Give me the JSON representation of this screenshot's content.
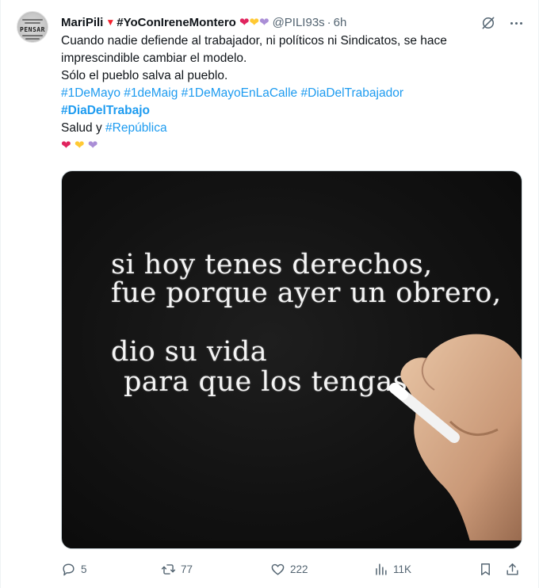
{
  "tweet": {
    "author_name": "MariPili",
    "author_flag": "▼",
    "author_hashtag": "#YoConIreneMontero",
    "handle": "@PILI93s",
    "separator": "·",
    "time": "6h",
    "text_line1": "Cuando nadie defiende al trabajador, ni políticos ni Sindicatos, se hace",
    "text_line2": "imprescindible cambiar el modelo.",
    "text_line3": "Sólo el pueblo salva al pueblo.",
    "hashtags_line": [
      "#1DeMayo",
      "#1deMaig",
      "#1DeMayoEnLaCalle",
      "#DiaDelTrabajador"
    ],
    "hashtag_bold": "#DiaDelTrabajo",
    "salud_prefix": "Salud y",
    "salud_hashtag": "#República",
    "hearts": [
      "❤",
      "❤",
      "❤"
    ]
  },
  "avatar": {
    "text": "PENSAR"
  },
  "media": {
    "line1": "si hoy tenes derechos,",
    "line2": "fue porque ayer un obrero,",
    "line3": "dio su vida",
    "line4": "para que los tengas."
  },
  "actions": {
    "replies": "5",
    "retweets": "77",
    "likes": "222",
    "views": "11K"
  },
  "icons": {
    "grok": "grok-icon",
    "more": "more-icon",
    "reply": "reply-icon",
    "retweet": "retweet-icon",
    "like": "like-icon",
    "views": "views-icon",
    "bookmark": "bookmark-icon",
    "share": "share-icon"
  },
  "colors": {
    "link": "#1d9bf0",
    "muted": "#536471",
    "text": "#0f1419",
    "heart_red": "#e0245e",
    "heart_yellow": "#ffc933",
    "heart_purple": "#aa8ed6"
  }
}
